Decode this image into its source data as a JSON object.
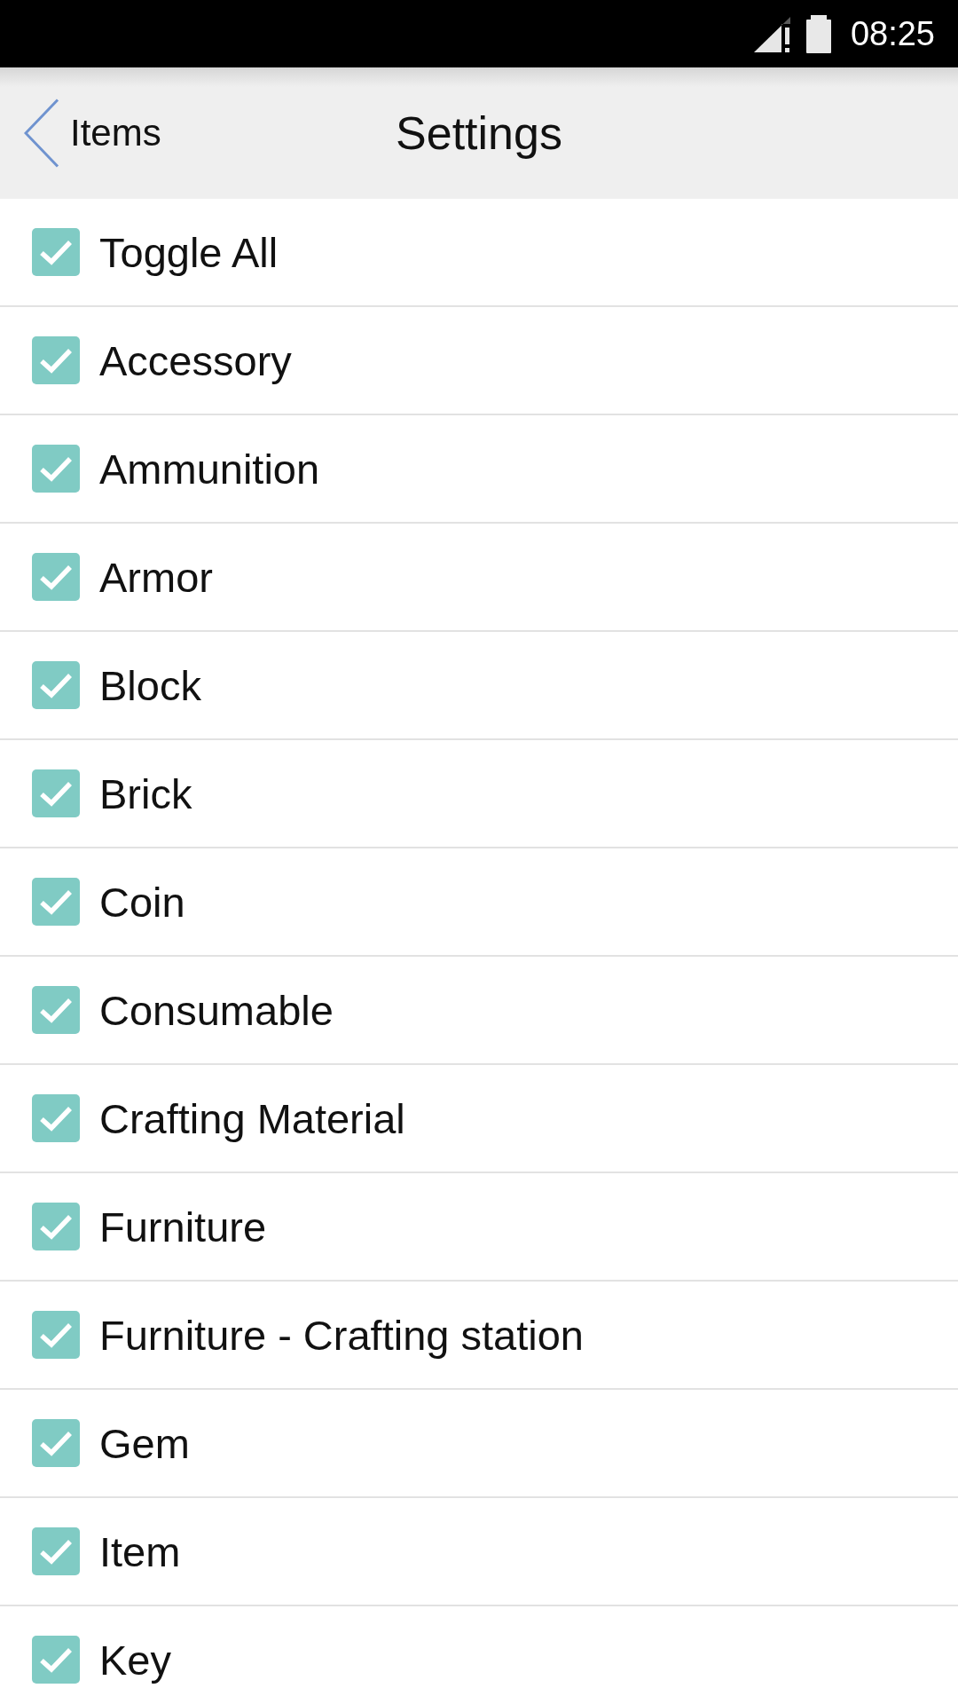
{
  "status_bar": {
    "time": "08:25"
  },
  "header": {
    "back_label": "Items",
    "title": "Settings"
  },
  "items": [
    {
      "label": "Toggle All",
      "checked": true
    },
    {
      "label": "Accessory",
      "checked": true
    },
    {
      "label": "Ammunition",
      "checked": true
    },
    {
      "label": "Armor",
      "checked": true
    },
    {
      "label": "Block",
      "checked": true
    },
    {
      "label": "Brick",
      "checked": true
    },
    {
      "label": "Coin",
      "checked": true
    },
    {
      "label": "Consumable",
      "checked": true
    },
    {
      "label": "Crafting Material",
      "checked": true
    },
    {
      "label": "Furniture",
      "checked": true
    },
    {
      "label": "Furniture - Crafting station",
      "checked": true
    },
    {
      "label": "Gem",
      "checked": true
    },
    {
      "label": "Item",
      "checked": true
    },
    {
      "label": "Key",
      "checked": true
    }
  ]
}
